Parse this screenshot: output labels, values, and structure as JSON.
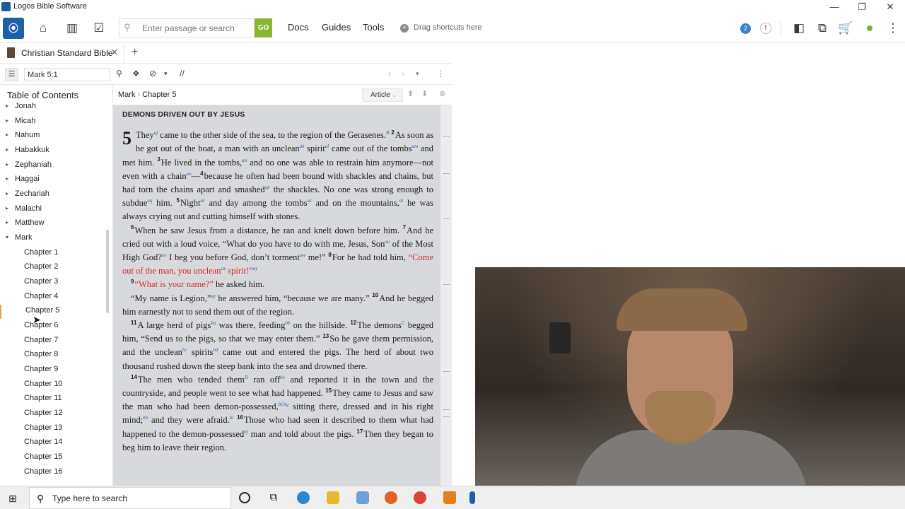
{
  "window": {
    "title": "Logos Bible Software"
  },
  "toolbar": {
    "logo_glyph": "⦿",
    "search_placeholder": "Enter passage or search",
    "go_label": "GO",
    "menus": [
      "Docs",
      "Guides",
      "Tools"
    ],
    "shortcuts_label": "Drag shortcuts here",
    "notification_count": "2",
    "alert_glyph": "!"
  },
  "tab": {
    "title": "Christian Standard Bible",
    "close": "✕",
    "new": "+"
  },
  "panel": {
    "reference": "Mark 5:1",
    "parallel_glyph": "//"
  },
  "toc": {
    "title": "Table of Contents",
    "books": [
      "Jonah",
      "Micah",
      "Nahum",
      "Habakkuk",
      "Zephaniah",
      "Haggai",
      "Zechariah",
      "Malachi",
      "Matthew",
      "Mark"
    ],
    "chapters": [
      "Chapter 1",
      "Chapter 2",
      "Chapter 3",
      "Chapter 4",
      "Chapter 5",
      "Chapter 6",
      "Chapter 7",
      "Chapter 8",
      "Chapter 9",
      "Chapter 10",
      "Chapter 11",
      "Chapter 12",
      "Chapter 13",
      "Chapter 14",
      "Chapter 15",
      "Chapter 16"
    ],
    "selected_chapter": "Chapter 5"
  },
  "reader": {
    "breadcrumb_book": "Mark",
    "breadcrumb_chapter": "Chapter 5",
    "view_mode": "Article",
    "heading": "DEMONS DRIVEN OUT BY JESUS",
    "chapter_number": "5"
  },
  "taskbar": {
    "search_placeholder": "Type here to search"
  },
  "colors": {
    "accent": "#1d5fa8",
    "go": "#86b72e",
    "red_letter": "#cf2828",
    "footnote": "#2d5fb0",
    "selected_marker": "#e8a23d"
  }
}
